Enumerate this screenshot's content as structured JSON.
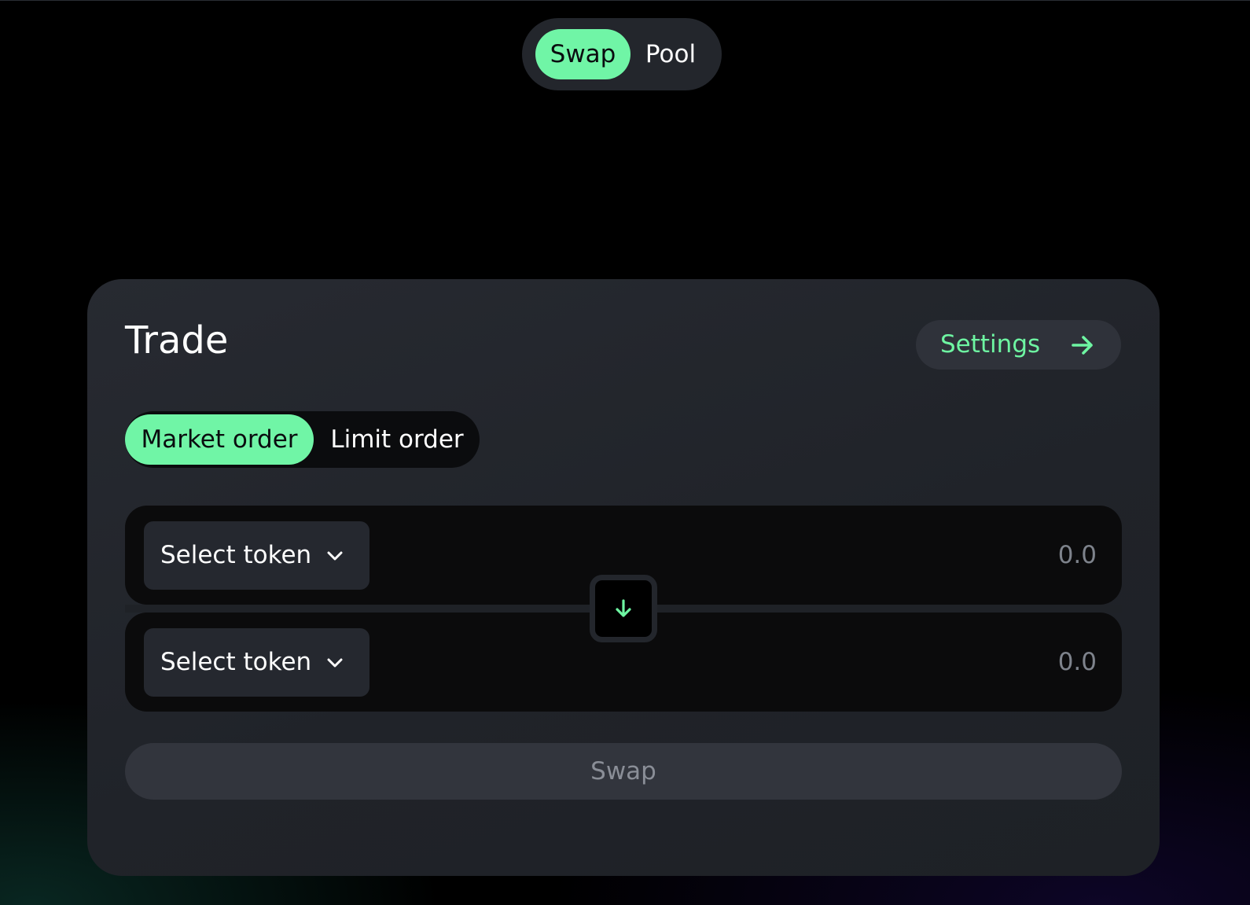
{
  "nav": {
    "tabs": [
      {
        "label": "Swap",
        "active": true
      },
      {
        "label": "Pool",
        "active": false
      }
    ]
  },
  "card": {
    "title": "Trade",
    "settings": {
      "label": "Settings",
      "icon": "arrow-right-icon"
    },
    "order_tabs": [
      {
        "label": "Market order",
        "active": true
      },
      {
        "label": "Limit order",
        "active": false
      }
    ],
    "from": {
      "token_label": "Select token",
      "token_icon": "chevron-down-icon",
      "amount_placeholder": "0.0"
    },
    "to": {
      "token_label": "Select token",
      "token_icon": "chevron-down-icon",
      "amount_placeholder": "0.0"
    },
    "switch_icon": "arrow-down-icon",
    "submit_label": "Swap"
  },
  "colors": {
    "accent": "#70f5a6",
    "background": "#000000",
    "card": "#23262c",
    "panel": "#0b0b0c",
    "muted_text": "#7e838c"
  }
}
